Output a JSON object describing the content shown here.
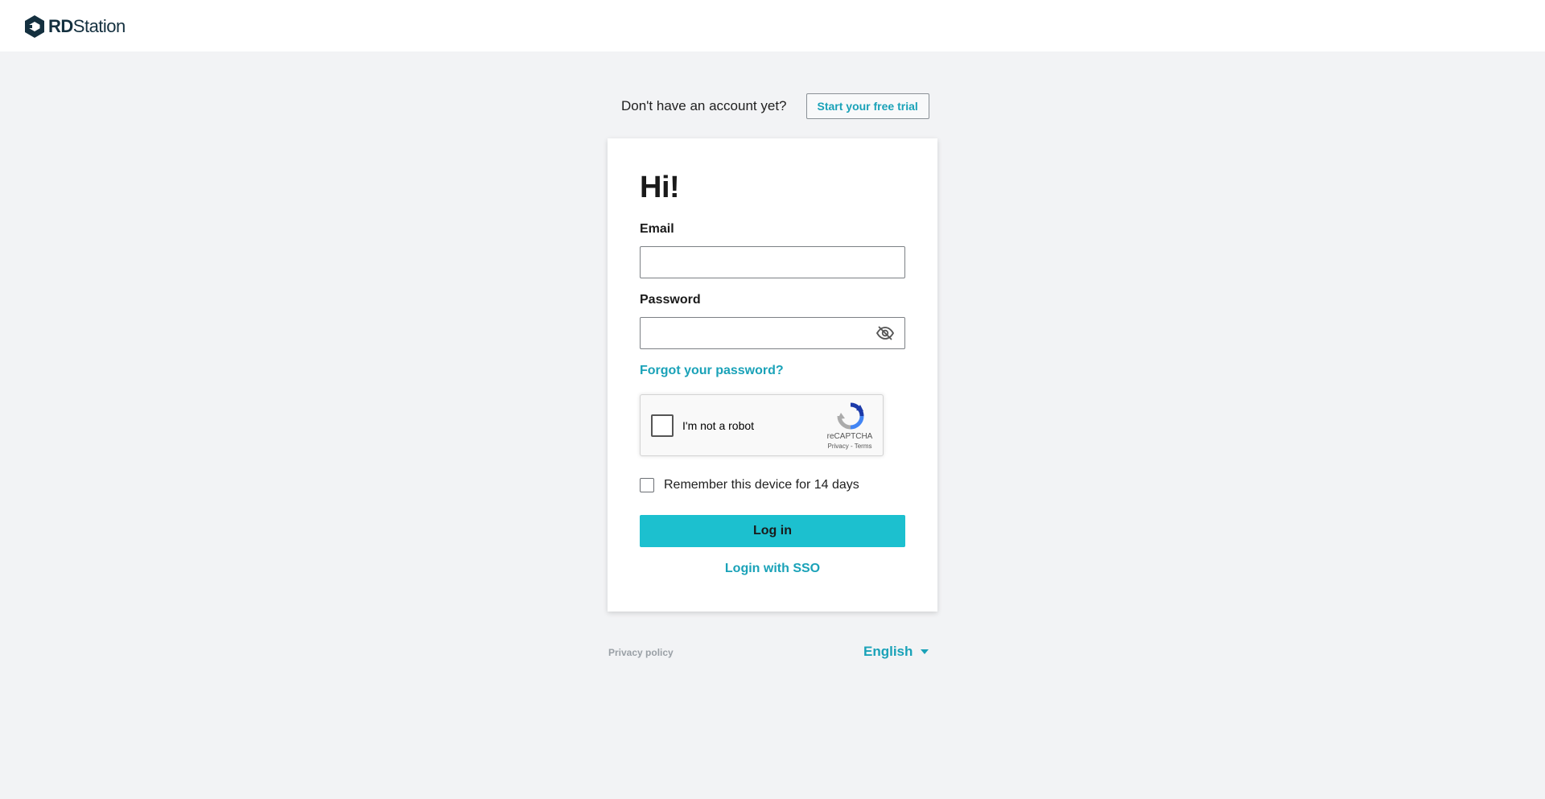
{
  "header": {
    "logo_text_bold": "RD",
    "logo_text_regular": "Station"
  },
  "signup": {
    "prompt": "Don't have an account yet?",
    "trial_button": "Start your free trial"
  },
  "login_form": {
    "greeting": "Hi!",
    "email_label": "Email",
    "email_value": "",
    "password_label": "Password",
    "password_value": "",
    "password_toggle_icon": "eye-slash-icon",
    "forgot_link": "Forgot your password?",
    "captcha": {
      "label": "I'm not a robot",
      "brand": "reCAPTCHA",
      "links": "Privacy - Terms",
      "checked": false
    },
    "remember_label": "Remember this device for 14 days",
    "remember_checked": false,
    "login_button": "Log in",
    "sso_link": "Login with SSO"
  },
  "footer": {
    "privacy_link": "Privacy policy",
    "language": "English"
  },
  "colors": {
    "accent": "#1aa2b8",
    "button": "#1cc0cf",
    "background": "#f2f3f5"
  }
}
